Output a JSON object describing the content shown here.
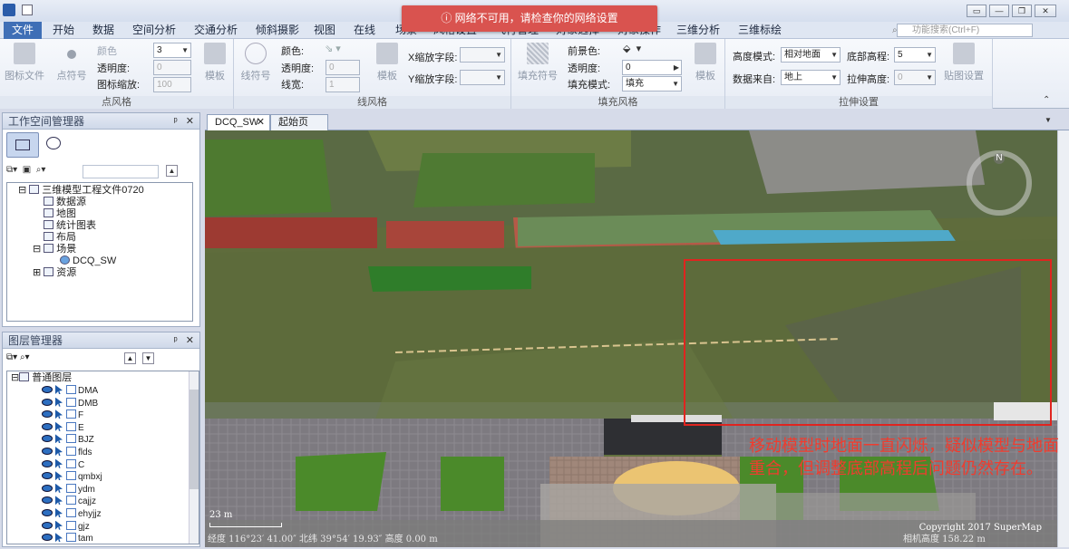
{
  "app": {
    "alert": "ⓘ  网络不可用，请检查你的网络设置",
    "search_placeholder": "功能搜索(Ctrl+F)"
  },
  "menus": [
    "文件",
    "开始",
    "数据",
    "空间分析",
    "交通分析",
    "倾斜摄影",
    "视图",
    "在线",
    "场景",
    "风格设置",
    "飞行管理",
    "对象选择",
    "对象操作",
    "三维分析",
    "三维标绘"
  ],
  "ribbon": {
    "point": {
      "title": "点风格",
      "icon_file": "图标文件",
      "point_symbol": "点符号",
      "color": "颜色",
      "opacity": "透明度:",
      "icon_scale": "图标缩放:",
      "size_value": "3",
      "opacity_value": "0",
      "scale_value": "100",
      "template": "模板"
    },
    "line": {
      "title": "线风格",
      "line_symbol": "线符号",
      "color": "颜色:",
      "opacity": "透明度:",
      "width": "线宽:",
      "opacity_value": "0",
      "width_value": "1",
      "template": "模板",
      "x_scale": "X缩放字段:",
      "y_scale": "Y缩放字段:"
    },
    "fill": {
      "title": "填充风格",
      "fill_symbol": "填充符号",
      "fg_color": "前景色:",
      "opacity": "透明度:",
      "fill_mode": "填充模式:",
      "opacity_value": "0",
      "fill_mode_value": "填充",
      "template": "模板"
    },
    "extrude": {
      "title": "拉伸设置",
      "height_mode": "高度模式:",
      "height_mode_value": "相对地面",
      "bottom_alt": "底部高程:",
      "bottom_alt_value": "5",
      "data_from": "数据来自:",
      "data_from_value": "地上",
      "extrude_height": "拉伸高度:",
      "extrude_height_value": "0",
      "texture": "贴图设置"
    }
  },
  "workspace": {
    "title": "工作空间管理器",
    "root": "三维模型工程文件0720",
    "items": [
      "数据源",
      "地图",
      "统计图表",
      "布局",
      "场景",
      "DCQ_SW",
      "资源"
    ]
  },
  "layers": {
    "title": "图层管理器",
    "group": "普通图层",
    "items": [
      "DMA",
      "DMB",
      "F",
      "E",
      "BJZ",
      "flds",
      "C",
      "qmbxj",
      "ydm",
      "cajjz",
      "ehyjjz",
      "gjz",
      "tam"
    ]
  },
  "tabs": [
    "DCQ_SW",
    "起始页"
  ],
  "scene": {
    "annotation": "移动模型时地面一直闪烁，疑似模型与地面重合，但调整底部高程后问题仍然存在。",
    "scale": "23 m",
    "status": "经度 116°23′ 41.00″  北纬 39°54′ 19.93″  高度 0.00 m",
    "copyright": "Copyright 2017 SuperMap",
    "camera": "相机高度 158.22 m",
    "compass_n": "N"
  },
  "colors": {
    "alert": "#d9534f",
    "annotation": "#f03c2e",
    "highlight_rect": "#e0241f",
    "menu_active": "#3f6fb6"
  }
}
